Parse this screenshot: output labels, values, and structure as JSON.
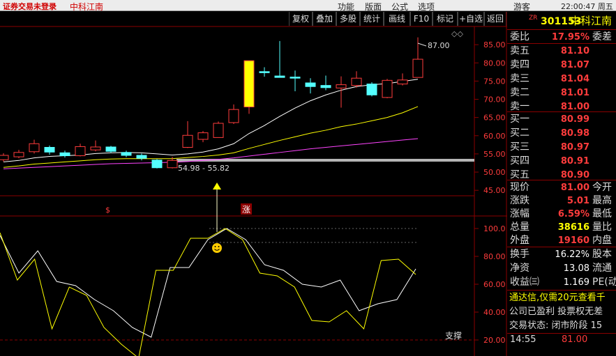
{
  "window": {
    "app_status": "证券交易未登录",
    "stock_name": "中科江南",
    "menu": [
      "功能",
      "版面",
      "公式",
      "选项"
    ],
    "user": "游客",
    "clock": "22:00:47 周五"
  },
  "toolbar": [
    "复权",
    "叠加",
    "多股",
    "统计",
    "画线",
    "F10",
    "标记",
    "+自选",
    "返回"
  ],
  "chart": {
    "y_ticks": [
      "85.00",
      "80.00",
      "75.00",
      "70.00",
      "65.00",
      "60.00",
      "55.00",
      "50.00",
      "45.00"
    ],
    "high_label": "87.00",
    "range_label": "54.98 - 55.82",
    "markers": {
      "s": "$",
      "zhang": "涨"
    },
    "ind_ticks": [
      "100.0",
      "80.00",
      "60.00",
      "40.00",
      "20.00"
    ],
    "support_label": "支撑",
    "diamond_icons": "◇◇"
  },
  "chart_data": {
    "type": "candlestick",
    "y_range": [
      43.5,
      90
    ],
    "candles": [
      {
        "o": 53.4,
        "c": 54.6,
        "h": 55.2,
        "l": 52.9
      },
      {
        "o": 54.2,
        "c": 55.4,
        "h": 56.1,
        "l": 53.8
      },
      {
        "o": 55.6,
        "c": 57.8,
        "h": 58.9,
        "l": 55.1
      },
      {
        "o": 56.8,
        "c": 55.5,
        "h": 57.3,
        "l": 54.8
      },
      {
        "o": 55.3,
        "c": 54.5,
        "h": 55.9,
        "l": 54.0
      },
      {
        "o": 54.5,
        "c": 57.0,
        "h": 57.8,
        "l": 54.3
      },
      {
        "o": 56.1,
        "c": 56.9,
        "h": 58.7,
        "l": 55.7
      },
      {
        "o": 56.9,
        "c": 55.7,
        "h": 57.2,
        "l": 55.3
      },
      {
        "o": 55.4,
        "c": 54.6,
        "h": 55.9,
        "l": 54.1
      },
      {
        "o": 54.6,
        "c": 53.8,
        "h": 55.1,
        "l": 53.2
      },
      {
        "o": 53.3,
        "c": 51.2,
        "h": 53.6,
        "l": 51.0
      },
      {
        "o": 51.2,
        "c": 53.2,
        "h": 54.2,
        "l": 51.0
      },
      {
        "o": 56.8,
        "c": 60.1,
        "h": 64.0,
        "l": 56.6
      },
      {
        "o": 59.0,
        "c": 60.8,
        "h": 61.3,
        "l": 58.2
      },
      {
        "o": 59.5,
        "c": 63.4,
        "h": 63.9,
        "l": 59.5
      },
      {
        "o": 63.6,
        "c": 67.2,
        "h": 68.6,
        "l": 63.2
      },
      {
        "o": 67.9,
        "c": 80.6,
        "h": 80.6,
        "l": 66.0
      },
      {
        "o": 77.6,
        "c": 77.3,
        "h": 78.8,
        "l": 76.2
      },
      {
        "o": 76.4,
        "c": 76.0,
        "h": 86.0,
        "l": 76.0
      },
      {
        "o": 76.1,
        "c": 75.8,
        "h": 77.9,
        "l": 72.2
      },
      {
        "o": 74.5,
        "c": 73.5,
        "h": 75.8,
        "l": 71.6
      },
      {
        "o": 73.8,
        "c": 73.2,
        "h": 76.5,
        "l": 72.5
      },
      {
        "o": 73.1,
        "c": 74.0,
        "h": 76.3,
        "l": 67.7
      },
      {
        "o": 73.8,
        "c": 75.8,
        "h": 77.7,
        "l": 73.2
      },
      {
        "o": 74.2,
        "c": 71.2,
        "h": 74.7,
        "l": 70.8
      },
      {
        "o": 70.5,
        "c": 75.2,
        "h": 75.6,
        "l": 70.3
      },
      {
        "o": 74.2,
        "c": 75.3,
        "h": 77.1,
        "l": 73.8
      },
      {
        "o": 76.0,
        "c": 81.0,
        "h": 87.0,
        "l": 76.0
      }
    ],
    "ma_white": [
      52.8,
      53.2,
      53.9,
      54.3,
      54.5,
      54.7,
      55.1,
      55.3,
      55.4,
      55.3,
      55.0,
      54.7,
      55.0,
      55.5,
      56.4,
      57.8,
      60.6,
      62.8,
      65.3,
      67.6,
      69.6,
      71.2,
      72.5,
      73.5,
      74.0,
      74.3,
      74.9,
      75.5
    ],
    "ma_yellow": [
      51.3,
      51.7,
      52.2,
      52.5,
      52.8,
      53.1,
      53.4,
      53.6,
      53.7,
      53.7,
      53.7,
      53.7,
      54.0,
      54.3,
      54.7,
      55.3,
      56.5,
      57.6,
      58.7,
      59.7,
      60.7,
      61.5,
      62.5,
      63.2,
      64.1,
      65.0,
      66.3,
      68.0
    ],
    "ma_purple": [
      50.9,
      51.1,
      51.3,
      51.5,
      51.7,
      51.9,
      52.1,
      52.3,
      52.4,
      52.5,
      52.6,
      52.7,
      52.9,
      53.2,
      53.5,
      53.9,
      54.4,
      54.9,
      55.4,
      55.9,
      56.4,
      56.8,
      57.2,
      57.6,
      58.0,
      58.4,
      58.8,
      59.2
    ],
    "indicator": {
      "y_range": [
        10,
        105
      ],
      "white": [
        95,
        68,
        84,
        62,
        59,
        49,
        41,
        29,
        22,
        72,
        72,
        92,
        100,
        92,
        74,
        70,
        60,
        58,
        63,
        41,
        46,
        49,
        71
      ],
      "yellow": [
        97,
        63,
        78,
        28,
        58,
        52,
        29,
        17,
        7,
        70,
        70,
        93,
        93,
        100,
        92,
        68,
        66,
        58,
        34,
        33,
        41,
        28,
        77,
        78,
        67
      ]
    }
  },
  "quote": {
    "prefix": "ZR",
    "code": "301153",
    "name": "中科江南",
    "weibi": {
      "label": "委比",
      "value": "17.95%",
      "label2": "委差"
    },
    "sell": [
      {
        "label": "卖五",
        "price": "81.10"
      },
      {
        "label": "卖四",
        "price": "81.07"
      },
      {
        "label": "卖三",
        "price": "81.04"
      },
      {
        "label": "卖二",
        "price": "81.01"
      },
      {
        "label": "卖一",
        "price": "81.00"
      }
    ],
    "buy": [
      {
        "label": "买一",
        "price": "80.99"
      },
      {
        "label": "买二",
        "price": "80.98"
      },
      {
        "label": "买三",
        "price": "80.97"
      },
      {
        "label": "买四",
        "price": "80.91"
      },
      {
        "label": "买五",
        "price": "80.90"
      }
    ],
    "stats": [
      {
        "label": "现价",
        "value": "81.00",
        "label2": "今开"
      },
      {
        "label": "涨跌",
        "value": "5.01",
        "label2": "最高"
      },
      {
        "label": "涨幅",
        "value": "6.59%",
        "label2": "最低"
      },
      {
        "label": "总量",
        "value": "38616",
        "label2": "量比"
      },
      {
        "label": "外盘",
        "value": "19160",
        "label2": "内盘"
      }
    ],
    "fund": [
      {
        "label": "换手",
        "value": "16.22%",
        "label2": "股本"
      },
      {
        "label": "净资",
        "value": "13.08",
        "label2": "流通"
      },
      {
        "label": "收益㈢",
        "value": "1.169",
        "label2": "PE(动"
      }
    ],
    "ad": "通达信,仅需20元查看千",
    "info1": "公司已盈利 投票权无差",
    "info2": "交易状态: 闭市阶段 15",
    "last_time": "14:55",
    "last_price": "81.00"
  },
  "colors": {
    "up": "#ff3c3c",
    "down": "#54ffff",
    "ma1": "#ffffff",
    "ma2": "#ffff00",
    "ma3": "#ff44ff",
    "grid": "#8b0000"
  }
}
